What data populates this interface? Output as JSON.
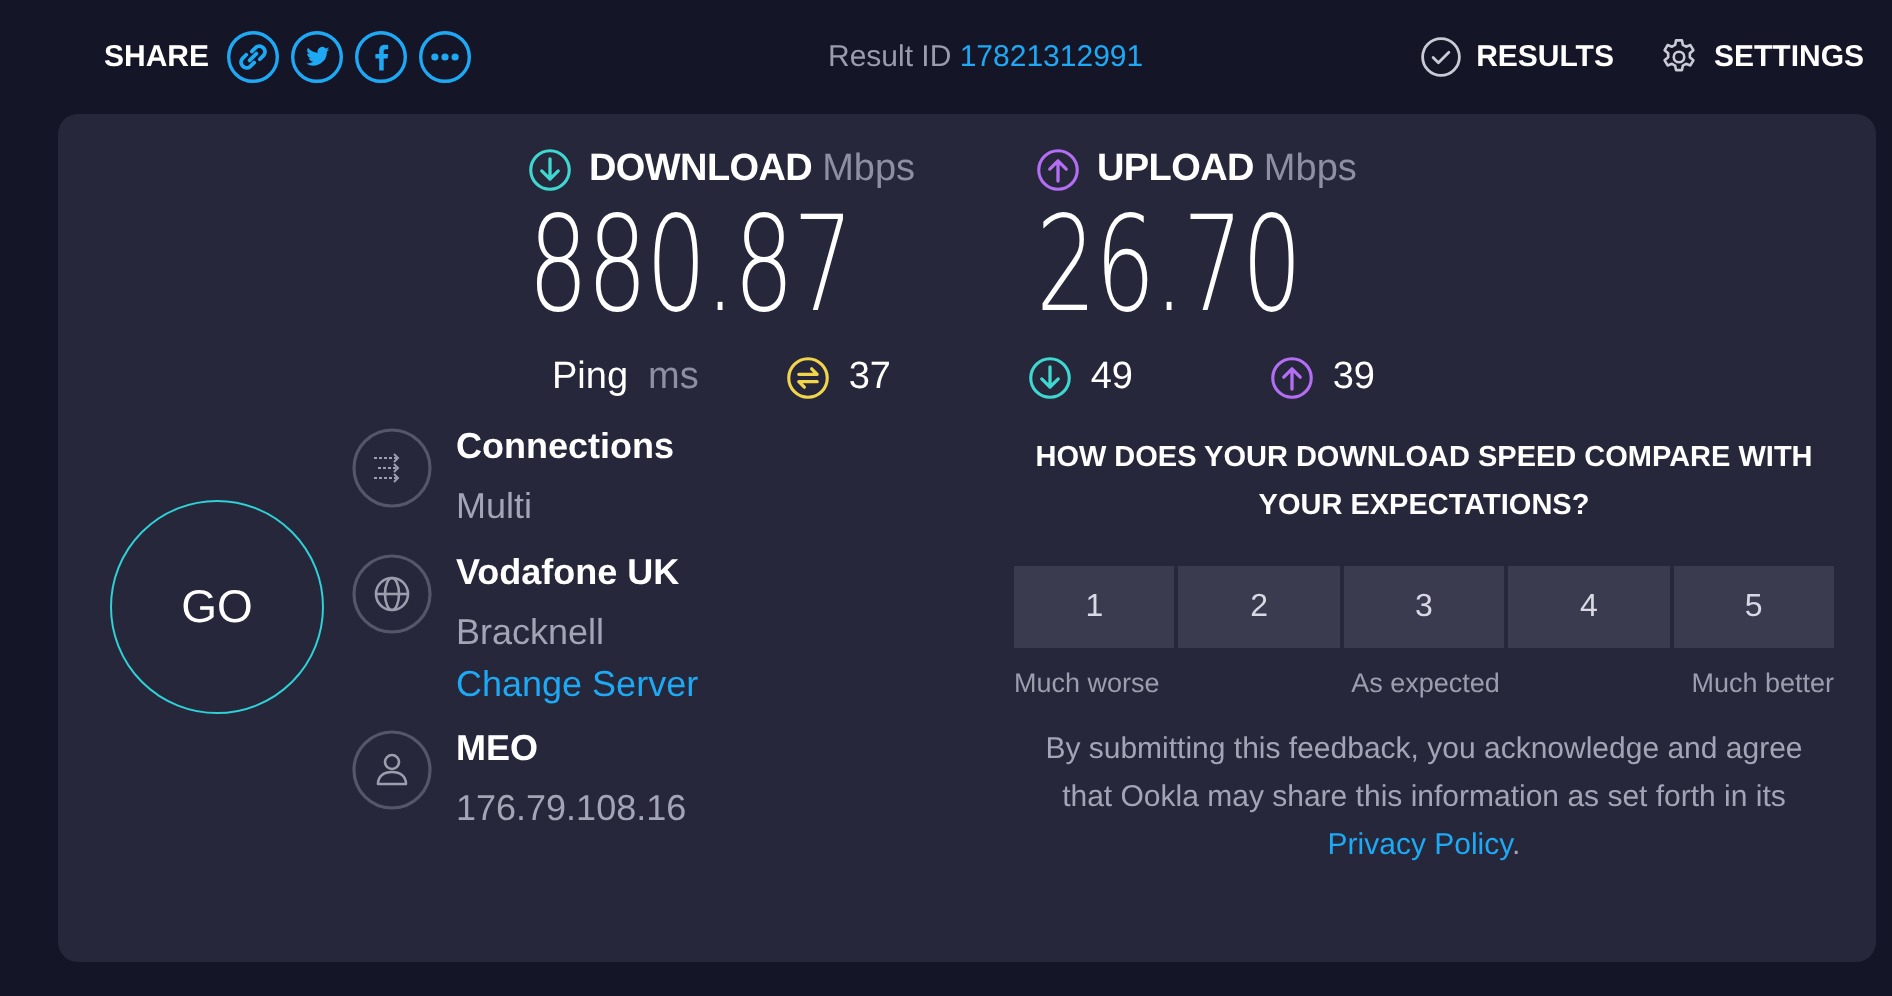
{
  "header": {
    "share_label": "SHARE",
    "share_links": [
      {
        "kind": "link"
      },
      {
        "kind": "twitter"
      },
      {
        "kind": "facebook"
      },
      {
        "kind": "more"
      }
    ],
    "result_id_label": "Result ID",
    "result_id": "17821312991",
    "nav": [
      {
        "kind": "results",
        "label": "RESULTS"
      },
      {
        "kind": "settings",
        "label": "SETTINGS"
      }
    ]
  },
  "speeds": [
    {
      "kind": "download",
      "label": "DOWNLOAD",
      "unit": "Mbps",
      "value": "880.87"
    },
    {
      "kind": "upload",
      "label": "UPLOAD",
      "unit": "Mbps",
      "value": "26.70"
    }
  ],
  "ping": {
    "label": "Ping",
    "unit": "ms",
    "items": [
      {
        "kind": "idle",
        "value": "37"
      },
      {
        "kind": "download",
        "value": "49"
      },
      {
        "kind": "upload",
        "value": "39"
      }
    ]
  },
  "go_button": "GO",
  "server_info": [
    {
      "kind": "connections",
      "title": "Connections",
      "subtitle": "Multi"
    },
    {
      "kind": "server",
      "title": "Vodafone UK",
      "subtitle": "Bracknell",
      "link": "Change Server"
    },
    {
      "kind": "isp",
      "title": "MEO",
      "subtitle": "176.79.108.16"
    }
  ],
  "survey": {
    "question": "HOW DOES YOUR DOWNLOAD SPEED COMPARE WITH YOUR EXPECTATIONS?",
    "options": [
      "1",
      "2",
      "3",
      "4",
      "5"
    ],
    "scale_labels": [
      "Much worse",
      "As expected",
      "Much better"
    ],
    "disclaimer": "By submitting this feedback, you acknowledge and agree that Ookla may share this information as set forth in its ",
    "privacy_link": "Privacy Policy",
    "disclaimer_end": "."
  }
}
